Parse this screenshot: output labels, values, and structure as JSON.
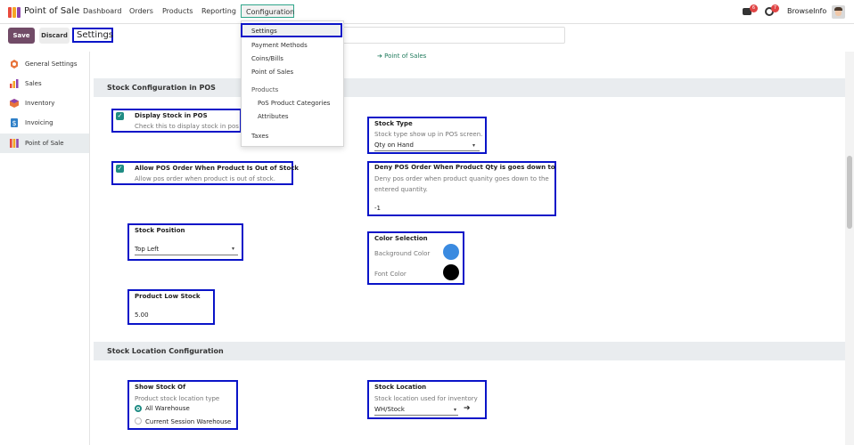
{
  "app": {
    "name": "Point of Sale"
  },
  "nav": {
    "menus": [
      "Dashboard",
      "Orders",
      "Products",
      "Reporting",
      "Configuration"
    ],
    "company": "BrowseInfo",
    "messages_badge": "6",
    "activity_badge": "7"
  },
  "toolbar": {
    "save_label": "Save",
    "discard_label": "Discard",
    "breadcrumb": "Settings"
  },
  "sidebar": {
    "items": [
      {
        "label": "General Settings",
        "icon": "gear-app-icon"
      },
      {
        "label": "Sales",
        "icon": "sales-chart-icon"
      },
      {
        "label": "Inventory",
        "icon": "inventory-box-icon"
      },
      {
        "label": "Invoicing",
        "icon": "invoice-icon"
      },
      {
        "label": "Point of Sale",
        "icon": "pos-store-icon"
      }
    ],
    "active": "Point of Sale"
  },
  "dropdown": {
    "items": [
      "Settings",
      "Payment Methods",
      "Coins/Bills",
      "Point of Sales"
    ],
    "products_header": "Products",
    "product_items": [
      "PoS Product Categories",
      "Attributes"
    ],
    "taxes": "Taxes"
  },
  "content": {
    "pos_link": "Point of Sales",
    "stock_config": {
      "header": "Stock Configuration in POS",
      "display_stock": {
        "title": "Display Stock in POS",
        "desc": "Check this to display stock in pos",
        "checked": true
      },
      "allow_order": {
        "title": "Allow POS Order When Product Is Out of Stock",
        "desc": "Allow pos order when product is out of stock.",
        "checked": true
      },
      "stock_type": {
        "title": "Stock Type",
        "desc": "Stock type show up in POS screen.",
        "value": "Qty on Hand"
      },
      "deny_order": {
        "title": "Deny POS Order When Product Qty is goes down to",
        "desc_line1": "Deny pos order when product quanity goes down to the",
        "desc_line2": "entered quantity.",
        "value": "-1"
      },
      "stock_position": {
        "title": "Stock Position",
        "value": "Top Left"
      },
      "color_selection": {
        "title": "Color Selection",
        "background_label": "Background Color",
        "font_label": "Font Color",
        "background_color": "#3a8ae0",
        "font_color": "#000000"
      },
      "low_stock": {
        "title": "Product Low Stock",
        "value": "5.00"
      }
    },
    "stock_location": {
      "header": "Stock Location Configuration",
      "show_stock_of": {
        "title": "Show Stock Of",
        "desc": "Product stock location type",
        "options": [
          "All Warehouse",
          "Current Session Warehouse"
        ],
        "selected": "All Warehouse"
      },
      "stock_location": {
        "title": "Stock Location",
        "desc": "Stock location used for inventory",
        "value": "WH/Stock"
      }
    }
  }
}
